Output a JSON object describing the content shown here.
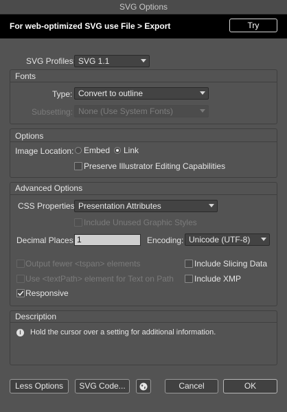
{
  "window": {
    "title": "SVG Options"
  },
  "banner": {
    "text": "For web-optimized SVG use File > Export",
    "try_label": "Try"
  },
  "profiles": {
    "label": "SVG Profiles:",
    "value": "SVG 1.1"
  },
  "fonts": {
    "section": "Fonts",
    "type_label": "Type:",
    "type_value": "Convert to outline",
    "subsetting_label": "Subsetting:",
    "subsetting_value": "None (Use System Fonts)"
  },
  "options": {
    "section": "Options",
    "image_location_label": "Image Location:",
    "embed_label": "Embed",
    "link_label": "Link",
    "preserve_label": "Preserve Illustrator Editing Capabilities"
  },
  "advanced": {
    "section": "Advanced Options",
    "css_label": "CSS Properties:",
    "css_value": "Presentation Attributes",
    "unused_styles_label": "Include Unused Graphic Styles",
    "decimal_label": "Decimal Places:",
    "decimal_value": "1",
    "encoding_label": "Encoding:",
    "encoding_value": "Unicode (UTF-8)",
    "tspan_label": "Output fewer <tspan> elements",
    "textpath_label": "Use <textPath> element for Text on Path",
    "responsive_label": "Responsive",
    "slicing_label": "Include Slicing Data",
    "xmp_label": "Include XMP"
  },
  "description": {
    "section": "Description",
    "text": "Hold the cursor over a setting for additional information."
  },
  "footer": {
    "less_options": "Less Options",
    "svg_code": "SVG Code...",
    "cancel": "Cancel",
    "ok": "OK"
  }
}
